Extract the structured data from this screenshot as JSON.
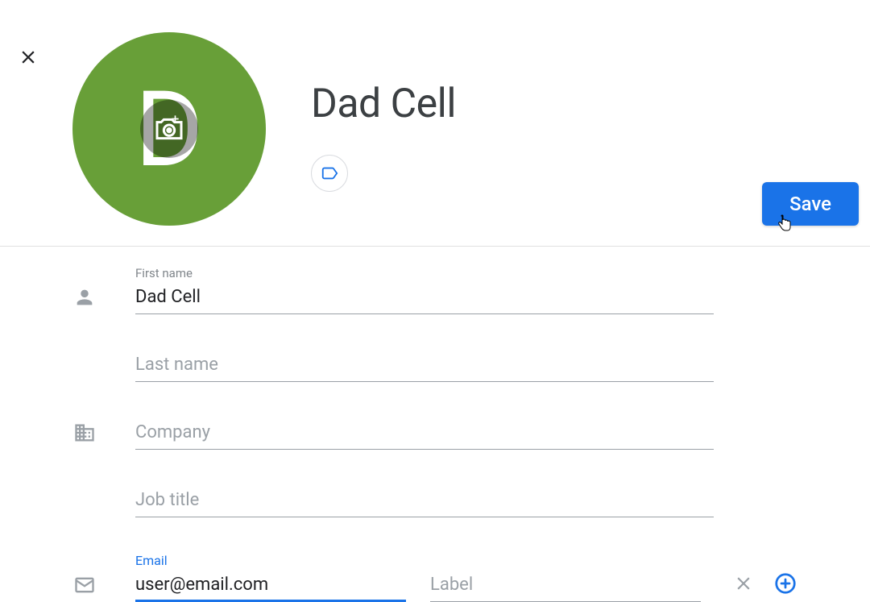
{
  "contact": {
    "display_name": "Dad Cell",
    "avatar_letter": "D",
    "avatar_color": "#689f38"
  },
  "buttons": {
    "save": "Save"
  },
  "fields": {
    "first_name": {
      "label": "First name",
      "value": "Dad Cell"
    },
    "last_name": {
      "label": "Last name",
      "placeholder": "Last name",
      "value": ""
    },
    "company": {
      "label": "Company",
      "placeholder": "Company",
      "value": ""
    },
    "job_title": {
      "label": "Job title",
      "placeholder": "Job title",
      "value": ""
    },
    "email": {
      "label": "Email",
      "value": "user@email.com"
    },
    "email_label": {
      "placeholder": "Label",
      "value": ""
    }
  }
}
